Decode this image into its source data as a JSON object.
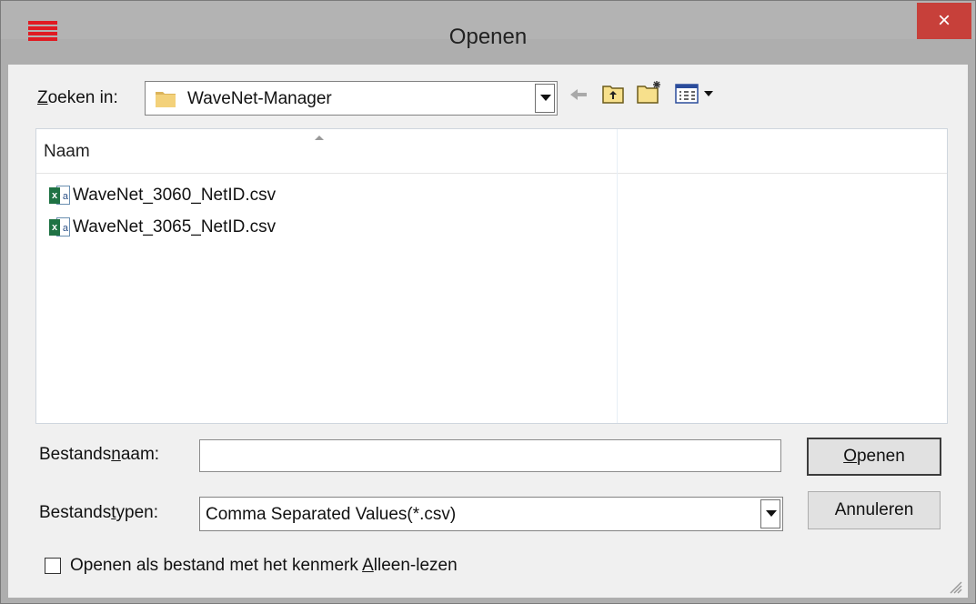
{
  "window": {
    "title": "Openen",
    "close_glyph": "×"
  },
  "lookin": {
    "label_pre": "",
    "label_u": "Z",
    "label_post": "oeken in:",
    "folder": "WaveNet-Manager",
    "folder_icon": "folder-icon"
  },
  "toolbar": {
    "back_icon": "back-arrow-icon",
    "up_icon": "up-folder-icon",
    "new_folder_icon": "new-folder-icon",
    "view_icon": "view-menu-icon"
  },
  "files": {
    "column_name": "Naam",
    "items": [
      {
        "name": "WaveNet_3060_NetID.csv",
        "icon": "excel-csv-icon"
      },
      {
        "name": "WaveNet_3065_NetID.csv",
        "icon": "excel-csv-icon"
      }
    ]
  },
  "filename": {
    "label_pre": "Bestands",
    "label_u": "n",
    "label_post": "aam:",
    "value": ""
  },
  "filetype": {
    "label_pre": "Bestands",
    "label_u": "t",
    "label_post": "ypen:",
    "selected": "Comma Separated Values(*.csv)"
  },
  "buttons": {
    "open_u": "O",
    "open_rest": "penen",
    "cancel": "Annuleren"
  },
  "readonly": {
    "label_pre": "Openen als bestand met het kenmerk ",
    "label_u": "A",
    "label_post": "lleen-lezen",
    "checked": false
  },
  "colors": {
    "accent_close": "#c7403a",
    "app_icon": "#e01b22",
    "excel_green": "#1f7244"
  }
}
